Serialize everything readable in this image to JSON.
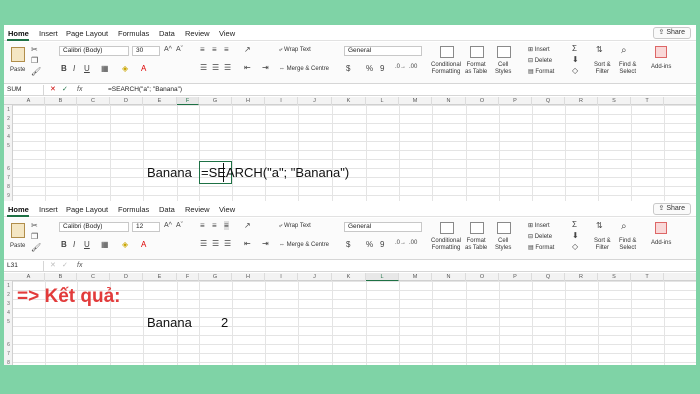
{
  "ribbon": {
    "tabs": [
      "Home",
      "Insert",
      "Page Layout",
      "Formulas",
      "Data",
      "Review",
      "View"
    ],
    "share_label": "Share",
    "paste_label": "Paste",
    "font_name": "Calibri (Body)",
    "font_size_top": "30",
    "font_size_bottom": "12",
    "bold": "B",
    "italic": "I",
    "underline": "U",
    "wrap_text": "Wrap Text",
    "merge_centre": "Merge & Centre",
    "number_format": "General",
    "percent": "%",
    "comma": "9",
    "conditional_1": "Conditional",
    "conditional_2": "Formatting",
    "format_table_1": "Format",
    "format_table_2": "as Table",
    "cell_styles_1": "Cell",
    "cell_styles_2": "Styles",
    "insert": "Insert",
    "delete": "Delete",
    "format": "Format",
    "sort_1": "Sort &",
    "sort_2": "Filter",
    "find_1": "Find &",
    "find_2": "Select",
    "addins_1": "Add-ins"
  },
  "top": {
    "name_box": "SUM",
    "formula": "=SEARCH(\"a\"; \"Banana\")",
    "cell_e5": "Banana",
    "cell_f5": "=SEARCH(\"a\"; \"Banana\")"
  },
  "bottom": {
    "name_box": "L31",
    "formula": "",
    "result_label": "=> Kết quả:",
    "cell_e5": "Banana",
    "cell_f5": "2"
  },
  "columns": [
    "A",
    "B",
    "C",
    "D",
    "E",
    "F",
    "G",
    "H",
    "I",
    "J",
    "K",
    "L",
    "M",
    "N",
    "O",
    "P",
    "Q",
    "R",
    "S",
    "T"
  ],
  "rows": [
    "1",
    "2",
    "3",
    "4",
    "5",
    "6",
    "7",
    "8",
    "9",
    "10"
  ],
  "colors": {
    "frame": "#7fd3a6",
    "excel_green": "#1e7145",
    "result_red": "#e23b3b"
  },
  "icons": [
    "scissors-icon",
    "copy-icon",
    "format-painter-icon",
    "cancel-icon",
    "enter-check-icon",
    "fx-icon",
    "autosum-icon",
    "search-icon",
    "share-icon"
  ]
}
